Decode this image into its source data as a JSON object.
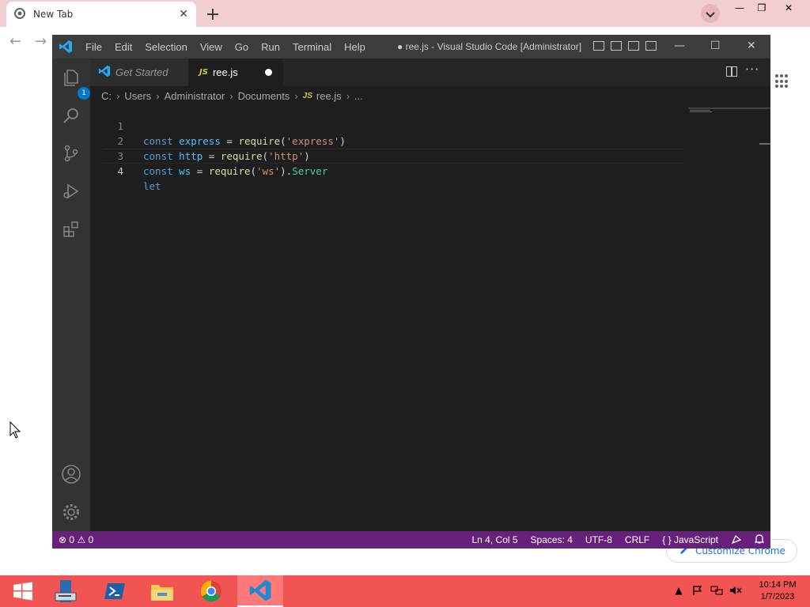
{
  "chrome": {
    "tab_title": "New Tab",
    "tab_close": "✕",
    "new_tab": "+",
    "minimize": "—",
    "restore": "❐",
    "close": "✕",
    "back": "←",
    "forward": "→",
    "customize_label": "Customize Chrome"
  },
  "vscode": {
    "menu": [
      "File",
      "Edit",
      "Selection",
      "View",
      "Go",
      "Run",
      "Terminal",
      "Help"
    ],
    "window_title": "● ree.js - Visual Studio Code [Administrator]",
    "win_min": "—",
    "win_max": "☐",
    "win_close": "✕",
    "explorer_badge": "1",
    "tabs": [
      {
        "label": "Get Started"
      },
      {
        "label": "ree.js",
        "badge": "JS"
      }
    ],
    "more_actions": "···",
    "breadcrumb": [
      "C:",
      "Users",
      "Administrator",
      "Documents",
      "ree.js",
      "..."
    ],
    "breadcrumb_js_badge": "JS",
    "line_numbers": [
      "1",
      "2",
      "3",
      "4"
    ],
    "code": {
      "l1": {
        "kw": "const",
        "var": "express",
        "eq": " = ",
        "fn": "require",
        "open": "(",
        "str": "'express'",
        "close": ")"
      },
      "l2": {
        "kw": "const",
        "var": "http",
        "eq": " = ",
        "fn": "require",
        "open": "(",
        "str": "'http'",
        "close": ")"
      },
      "l3": {
        "kw": "const",
        "var": "ws",
        "eq": " = ",
        "fn": "require",
        "open": "(",
        "str": "'ws'",
        "close": ").",
        "cls": "Server"
      },
      "l4": {
        "kw": "let"
      }
    },
    "status": {
      "errors": "0",
      "warnings": "0",
      "position": "Ln 4, Col 5",
      "spaces": "Spaces: 4",
      "encoding": "UTF-8",
      "eol": "CRLF",
      "braces": "{ }",
      "language": "JavaScript"
    },
    "status_color": "#68217a"
  },
  "taskbar": {
    "clock_time": "10:14 PM",
    "clock_date": "1/7/2023",
    "tray_up": "▲",
    "color": "#f25454"
  }
}
